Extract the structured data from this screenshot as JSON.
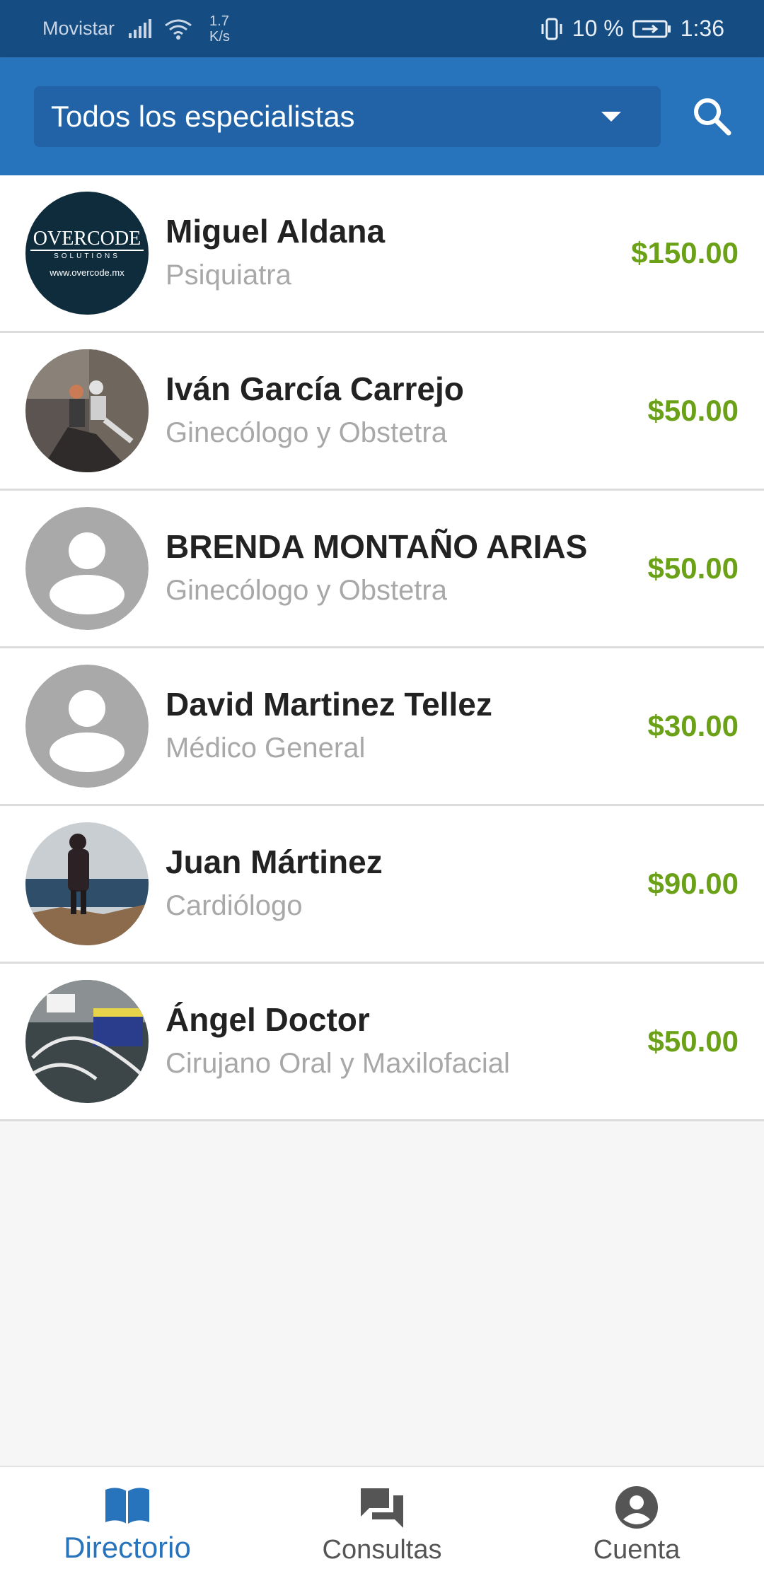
{
  "status_bar": {
    "carrier": "Movistar",
    "speed_value": "1.7",
    "speed_unit": "K/s",
    "battery": "10 %",
    "time": "1:36"
  },
  "header": {
    "filter_label": "Todos los especialistas",
    "search_icon": "search-icon"
  },
  "specialists": [
    {
      "name": "Miguel Aldana",
      "specialty": "Psiquiatra",
      "price": "$150.00",
      "avatar": "overcode-logo"
    },
    {
      "name": "Iván García Carrejo",
      "specialty": "Ginecólogo y Obstetra",
      "price": "$50.00",
      "avatar": "climbing-photo"
    },
    {
      "name": "BRENDA MONTAÑO ARIAS",
      "specialty": "Ginecólogo y Obstetra",
      "price": "$50.00",
      "avatar": "default-avatar"
    },
    {
      "name": "David Martinez Tellez",
      "specialty": "Médico General",
      "price": "$30.00",
      "avatar": "default-avatar"
    },
    {
      "name": "Juan Mártinez",
      "specialty": "Cardiólogo",
      "price": "$90.00",
      "avatar": "seaside-photo"
    },
    {
      "name": "Ángel Doctor",
      "specialty": "Cirujano Oral y Maxilofacial",
      "price": "$50.00",
      "avatar": "desk-photo"
    }
  ],
  "logo": {
    "brand": "OVERCODE",
    "tagline": "SOLUTIONS",
    "url": "www.overcode.mx"
  },
  "bottom_nav": [
    {
      "label": "Directorio",
      "icon": "book-icon",
      "active": true
    },
    {
      "label": "Consultas",
      "icon": "chat-icon",
      "active": false
    },
    {
      "label": "Cuenta",
      "icon": "account-icon",
      "active": false
    }
  ],
  "colors": {
    "primary": "#2774bd",
    "status_bar": "#154c82",
    "price": "#6ba117"
  }
}
